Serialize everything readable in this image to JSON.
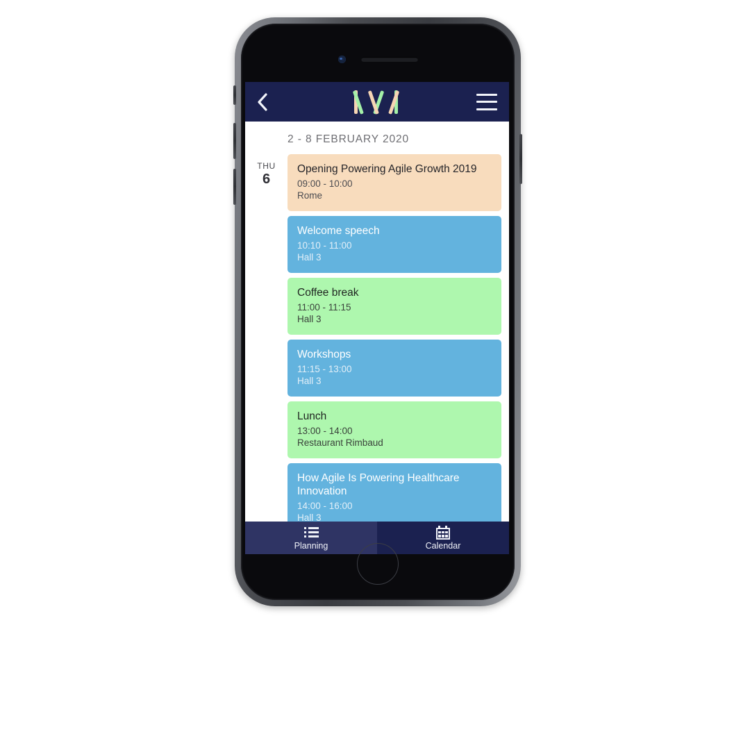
{
  "device": {
    "name": "smartphone-mockup",
    "front_camera_icon": "camera-icon",
    "earpiece_icon": "speaker-icon",
    "home_button_icon": "home-button-icon"
  },
  "header": {
    "back_icon": "chevron-left-icon",
    "menu_icon": "hamburger-menu-icon",
    "logo_text": "IWI",
    "logo_colors": {
      "peach": "#F6D5B4",
      "green": "#A4F0A8"
    },
    "background": "#1B2150"
  },
  "agenda": {
    "date_range": "2 - 8 FEBRUARY 2020",
    "day": {
      "weekday": "THU",
      "number": "6"
    },
    "events": [
      {
        "title": "Opening Powering Agile Growth 2019",
        "time": "09:00 - 10:00",
        "location": "Rome",
        "color": "#F8DCBD",
        "theme": "peach"
      },
      {
        "title": "Welcome speech",
        "time": "10:10 - 11:00",
        "location": "Hall 3",
        "color": "#63B3DE",
        "theme": "blue"
      },
      {
        "title": "Coffee break",
        "time": "11:00 - 11:15",
        "location": "Hall 3",
        "color": "#AEF7AE",
        "theme": "green"
      },
      {
        "title": "Workshops",
        "time": "11:15 - 13:00",
        "location": "Hall 3",
        "color": "#63B3DE",
        "theme": "blue"
      },
      {
        "title": "Lunch",
        "time": "13:00 - 14:00",
        "location": "Restaurant Rimbaud",
        "color": "#AEF7AE",
        "theme": "green"
      },
      {
        "title": "How Agile Is Powering Healthcare Innovation",
        "time": "14:00 - 16:00",
        "location": "Hall 3",
        "color": "#63B3DE",
        "theme": "blue"
      }
    ]
  },
  "tab_bar": {
    "items": [
      {
        "label": "Planning",
        "icon": "list-icon",
        "active": true
      },
      {
        "label": "Calendar",
        "icon": "calendar-icon",
        "active": false
      }
    ]
  }
}
